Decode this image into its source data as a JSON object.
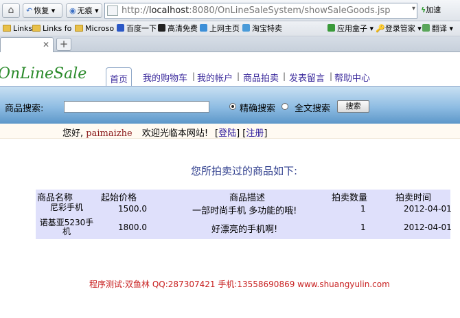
{
  "browser": {
    "home_icon": "home-icon",
    "back_label": "恢复",
    "noimage_label": "无痕",
    "url_host": "localhost",
    "url_prefix": "http://",
    "url_rest": ":8080/OnLineSaleSystem/showSaleGoods.jsp",
    "accelerate_label": "加速",
    "bookmarks": [
      {
        "label": "Links",
        "icon": "folder-icon"
      },
      {
        "label": "Links fo",
        "icon": "folder-icon"
      },
      {
        "label": "Microso",
        "icon": "folder-icon"
      },
      {
        "label": "百度一下",
        "icon": "baidu-icon"
      },
      {
        "label": "高清免费",
        "icon": "movie-icon"
      },
      {
        "label": "上网主页",
        "icon": "home-page-icon"
      },
      {
        "label": "淘宝特卖",
        "icon": "taobao-icon"
      },
      {
        "label": "应用盒子",
        "icon": "app-box-icon"
      },
      {
        "label": "登录管家",
        "icon": "key-icon"
      },
      {
        "label": "翻译",
        "icon": "translate-icon"
      }
    ]
  },
  "site": {
    "logo": "OnLineSale",
    "nav": [
      "首页",
      "我的购物车",
      "我的帐户",
      "商品拍卖",
      "发表留言",
      "帮助中心"
    ],
    "search": {
      "label": "商品搜索:",
      "value": "",
      "options": [
        "精确搜索",
        "全文搜索"
      ],
      "selected": "精确搜索",
      "button": "搜索"
    },
    "welcome": {
      "greeting": "您好,",
      "username": "paimaizhe",
      "message": "欢迎光临本网站!",
      "login": "登陆",
      "register": "注册"
    }
  },
  "goods": {
    "heading": "您所拍卖过的商品如下:",
    "columns": [
      "商品名称",
      "起始价格",
      "商品描述",
      "拍卖数量",
      "拍卖时间"
    ],
    "rows": [
      {
        "name": "尼彩手机",
        "price": "1500.0",
        "desc": "一部时尚手机 多功能的哦!",
        "qty": "1",
        "date": "2012-04-01"
      },
      {
        "name_line1": "诺基亚5230手",
        "name_line2": "机",
        "price": "1800.0",
        "desc": "好漂亮的手机啊!",
        "qty": "1",
        "date": "2012-04-01"
      }
    ]
  },
  "footer": "程序测试:双鱼林 QQ:287307421 手机:13558690869 www.shuangyulin.com",
  "colors": {
    "logo": "#2a8a2a",
    "nav_text": "#3b2a9c",
    "table_bg": "#dfe0fb",
    "footer": "#c82020",
    "search_bar": "#8fbde3"
  }
}
